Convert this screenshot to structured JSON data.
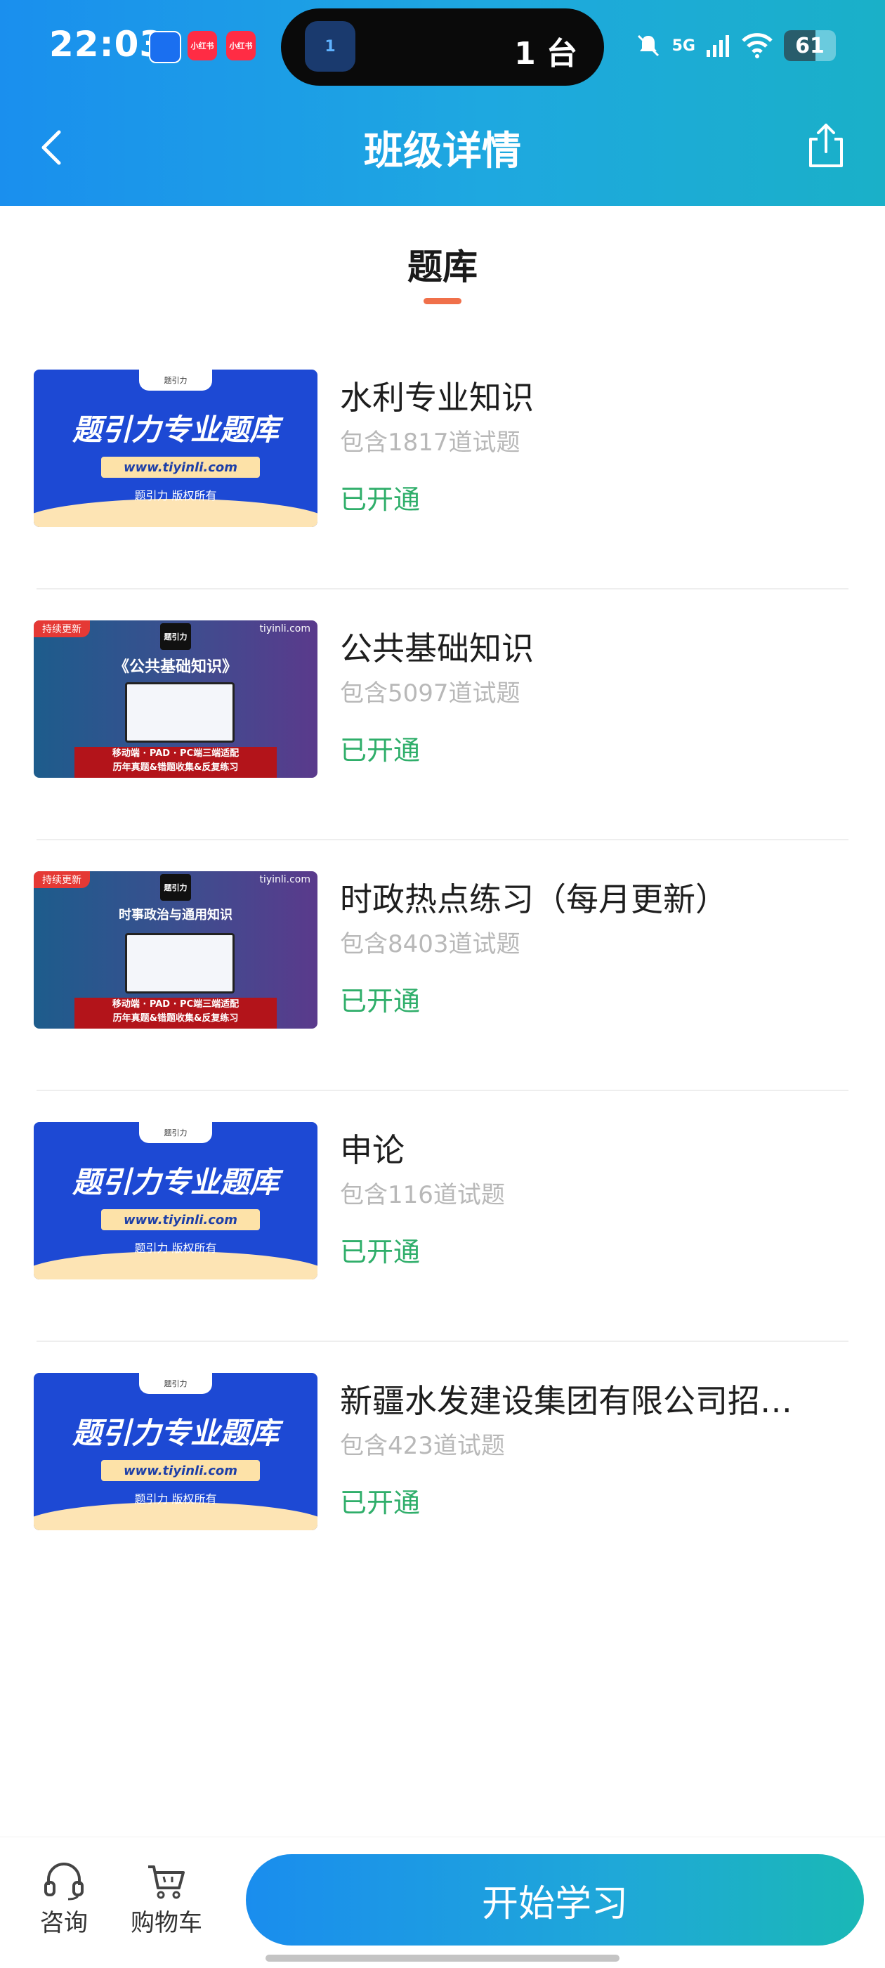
{
  "status": {
    "time": "22:03",
    "app_badges": [
      "",
      "小红书",
      "小红书"
    ],
    "island_badge": "1",
    "island_text": "1 台",
    "network": "5G",
    "battery": "61"
  },
  "header": {
    "title": "班级详情"
  },
  "section": {
    "title": "题库"
  },
  "thumb_text": {
    "brand_tab": "题引力",
    "headline": "题引力专业题库",
    "url": "www.tiyinli.com",
    "copyright": "题引力 版权所有",
    "tag": "持续更新",
    "site": "tiyinli.com",
    "logo": "题引力",
    "footer_line1": "移动端 · PAD · PC端三端适配",
    "footer_line2": "历年真题&错题收集&反复练习",
    "b_head_1": "《公共基础知识》",
    "b_head_2": "时事政治与通用知识"
  },
  "banks": [
    {
      "name": "水利专业知识",
      "count": "包含1817道试题",
      "status": "已开通"
    },
    {
      "name": "公共基础知识",
      "count": "包含5097道试题",
      "status": "已开通"
    },
    {
      "name": "时政热点练习（每月更新）",
      "count": "包含8403道试题",
      "status": "已开通"
    },
    {
      "name": "申论",
      "count": "包含116道试题",
      "status": "已开通"
    },
    {
      "name": "新疆水发建设集团有限公司招…",
      "count": "包含423道试题",
      "status": "已开通"
    }
  ],
  "bottom": {
    "consult_label": "咨询",
    "cart_label": "购物车",
    "start_label": "开始学习"
  },
  "colors": {
    "accent_green": "#2fae6a",
    "header_blue": "#1a8fee",
    "tab_indicator": "#f0704a"
  }
}
